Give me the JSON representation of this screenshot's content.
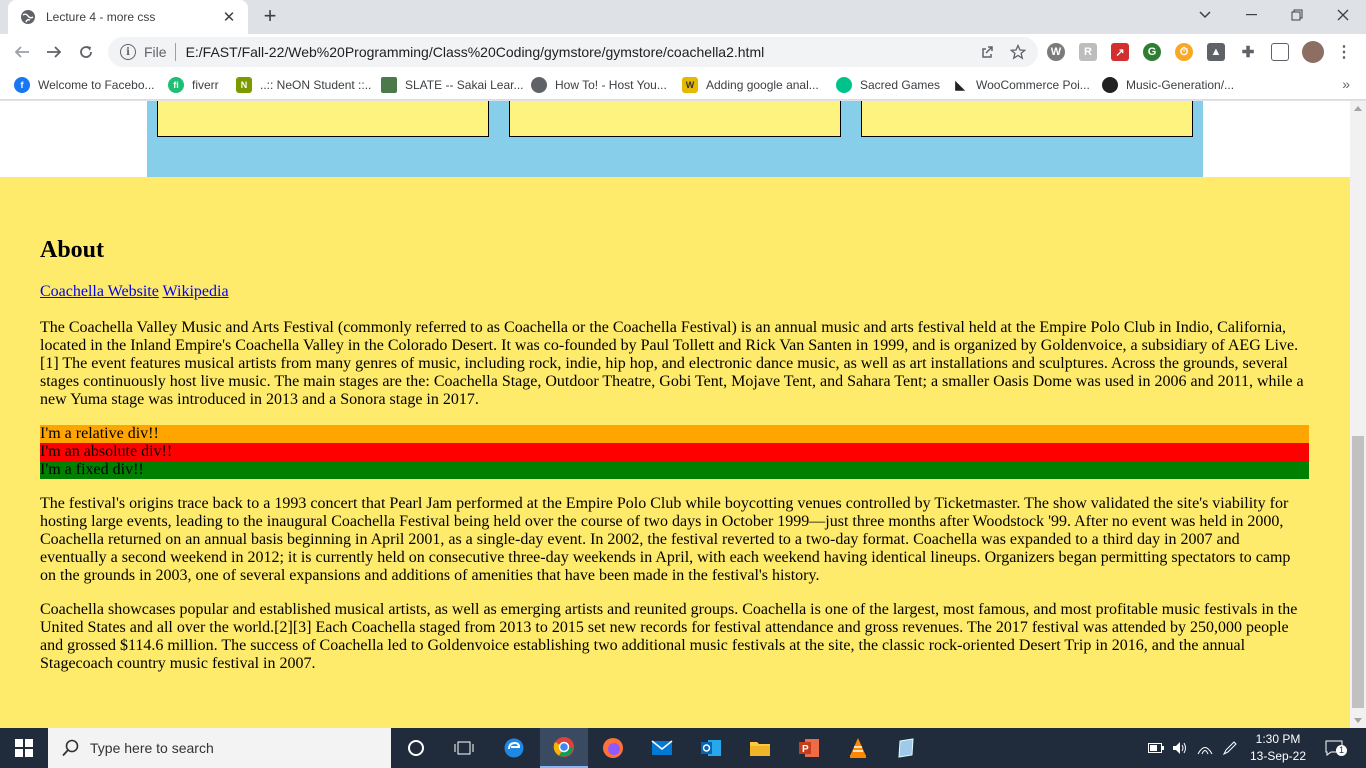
{
  "browser": {
    "tab_title": "Lecture 4 - more css",
    "scheme": "File",
    "url": "E:/FAST/Fall-22/Web%20Programming/Class%20Coding/gymstore/gymstore/coachella2.html"
  },
  "bookmarks": [
    {
      "label": "Welcome to Facebo...",
      "icon": "facebook-icon",
      "color": "#1877f2"
    },
    {
      "label": "fiverr",
      "icon": "fiverr-icon",
      "color": "#1dbf73"
    },
    {
      "label": "..:: NeON Student ::..",
      "icon": "neon-icon",
      "color": "#7a9a00"
    },
    {
      "label": "SLATE -- Sakai Lear...",
      "icon": "slate-icon",
      "color": "#4a7a4a"
    },
    {
      "label": "How To! - Host You...",
      "icon": "globe-icon",
      "color": "#5f6368"
    },
    {
      "label": "Adding google anal...",
      "icon": "w-icon",
      "color": "#e6b800"
    },
    {
      "label": "Sacred Games",
      "icon": "circle-icon",
      "color": "#00c28b"
    },
    {
      "label": "WooCommerce Poi...",
      "icon": "woo-icon",
      "color": "#222222"
    },
    {
      "label": "Music-Generation/...",
      "icon": "github-icon",
      "color": "#222222"
    }
  ],
  "page": {
    "about_heading": "About",
    "link_coachella": "Coachella Website",
    "link_wikipedia": "Wikipedia",
    "para1": "The Coachella Valley Music and Arts Festival (commonly referred to as Coachella or the Coachella Festival) is an annual music and arts festival held at the Empire Polo Club in Indio, California, located in the Inland Empire's Coachella Valley in the Colorado Desert. It was co-founded by Paul Tollett and Rick Van Santen in 1999, and is organized by Goldenvoice, a subsidiary of AEG Live.[1] The event features musical artists from many genres of music, including rock, indie, hip hop, and electronic dance music, as well as art installations and sculptures. Across the grounds, several stages continuously host live music. The main stages are the: Coachella Stage, Outdoor Theatre, Gobi Tent, Mojave Tent, and Sahara Tent; a smaller Oasis Dome was used in 2006 and 2011, while a new Yuma stage was introduced in 2013 and a Sonora stage in 2017.",
    "relative_div": "I'm a relative div!!",
    "absolute_div": "I'm an absolute div!!",
    "fixed_div": "I'm a fixed div!!",
    "para2": "The festival's origins trace back to a 1993 concert that Pearl Jam performed at the Empire Polo Club while boycotting venues controlled by Ticketmaster. The show validated the site's viability for hosting large events, leading to the inaugural Coachella Festival being held over the course of two days in October 1999—just three months after Woodstock '99. After no event was held in 2000, Coachella returned on an annual basis beginning in April 2001, as a single-day event. In 2002, the festival reverted to a two-day format. Coachella was expanded to a third day in 2007 and eventually a second weekend in 2012; it is currently held on consecutive three-day weekends in April, with each weekend having identical lineups. Organizers began permitting spectators to camp on the grounds in 2003, one of several expansions and additions of amenities that have been made in the festival's history.",
    "para3": "Coachella showcases popular and established musical artists, as well as emerging artists and reunited groups. Coachella is one of the largest, most famous, and most profitable music festivals in the United States and all over the world.[2][3] Each Coachella staged from 2013 to 2015 set new records for festival attendance and gross revenues. The 2017 festival was attended by 250,000 people and grossed $114.6 million. The success of Coachella led to Goldenvoice establishing two additional music festivals at the site, the classic rock-oriented Desert Trip in 2016, and the annual Stagecoach country music festival in 2007."
  },
  "colors": {
    "about_bg": "#ffeb6b",
    "blue_section": "#87ceeb",
    "box_yellow": "#fff380",
    "relative": "#ffa500",
    "absolute": "#ff0000",
    "fixed": "#008000"
  },
  "taskbar": {
    "search_placeholder": "Type here to search",
    "time": "1:30 PM",
    "date": "13-Sep-22",
    "notification_count": "1"
  }
}
